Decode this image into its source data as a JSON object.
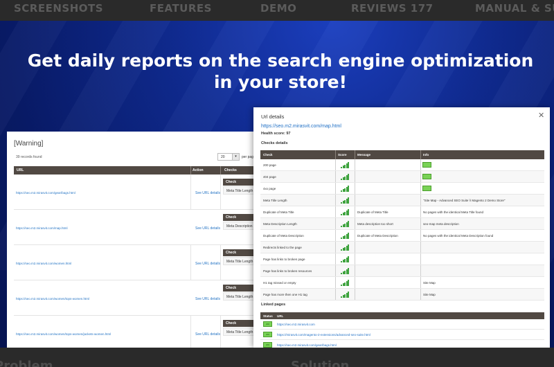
{
  "nav": {
    "items": [
      "SCREENSHOTS",
      "FEATURES",
      "DEMO",
      "REVIEWS 177",
      "MANUAL & SUP"
    ]
  },
  "hero": {
    "line1": "Get daily reports on the search engine optimization",
    "line2": "in your store!"
  },
  "bottom": {
    "left": "Problem",
    "right": "Solution"
  },
  "grid": {
    "title": "[Warning]",
    "records": "39 records found",
    "per_page_value": "20",
    "per_page_label": "per pag",
    "columns": [
      "URL",
      "Action",
      "Checks"
    ],
    "rows": [
      {
        "url": "https://seo.m2.mirasvit.com/gear/bags.html",
        "action": "See URL details",
        "check_head": "Check",
        "check_value": "Meta Title Length"
      },
      {
        "url": "https://seo.m2.mirasvit.com/map.html",
        "action": "See URL details",
        "check_head": "Check",
        "check_value": "Meta Description Le"
      },
      {
        "url": "https://seo.m2.mirasvit.com/women.html",
        "action": "See URL details",
        "check_head": "Check",
        "check_value": "Meta Title Length"
      },
      {
        "url": "https://seo.m2.mirasvit.com/women/tops-women.html",
        "action": "See URL details",
        "check_head": "Check",
        "check_value": "Meta Title Length"
      },
      {
        "url": "https://seo.m2.mirasvit.com/women/tops-women/jackets-women.html",
        "action": "See URL details",
        "check_head": "Check",
        "check_value": "Meta Title Length"
      }
    ]
  },
  "modal": {
    "title": "Url details",
    "url": "https://seo.m2.mirasvit.com/map.html",
    "health": "Health score: 97",
    "checks_title": "Checks details",
    "columns": [
      "Check",
      "Score",
      "Message",
      "Info"
    ],
    "rows": [
      {
        "check": "200 page",
        "message": "",
        "info": "",
        "badge": true,
        "score": 5
      },
      {
        "check": "404 page",
        "message": "",
        "info": "",
        "badge": true,
        "score": 5
      },
      {
        "check": "4xx page",
        "message": "",
        "info": "",
        "badge": true,
        "score": 5
      },
      {
        "check": "Meta Title Length",
        "message": "",
        "info": "\"Site Map - Advanced SEO Suite \\\\ Magento 2 Demo Store\"",
        "badge": false,
        "score": 5
      },
      {
        "check": "Duplicate of Meta Title",
        "message": "Duplicate of Meta Title",
        "info": "No pages with the identical Meta Title found",
        "badge": false,
        "score": 5
      },
      {
        "check": "Meta Description Length",
        "message": "Meta description too short",
        "info": "seo-map meta description",
        "badge": false,
        "score": 5
      },
      {
        "check": "Duplicate of Meta Description",
        "message": "Duplicate of Meta Description",
        "info": "No pages with the identical Meta Description found",
        "badge": false,
        "score": 5
      },
      {
        "check": "Redirects linked to the page",
        "message": "",
        "info": "",
        "badge": false,
        "score": 5
      },
      {
        "check": "Page has links to broken page",
        "message": "",
        "info": "",
        "badge": false,
        "score": 5
      },
      {
        "check": "Page has links to broken resources",
        "message": "",
        "info": "",
        "badge": false,
        "score": 5
      },
      {
        "check": "H1 tag missed or empty",
        "message": "",
        "info": "Site Map",
        "badge": false,
        "score": 5
      },
      {
        "check": "Page has more then one H1 tag",
        "message": "",
        "info": "Site Map",
        "badge": false,
        "score": 5
      }
    ],
    "linked_title": "Linked pages",
    "linked_columns": [
      "Status",
      "URL"
    ],
    "linked": [
      {
        "status": "200",
        "url": "https://seo.m2.mirasvit.com"
      },
      {
        "status": "200",
        "url": "https://mirasvit.com/magento-2-extensions/advanced-seo-suite.html"
      },
      {
        "status": "200",
        "url": "https://seo.m2.mirasvit.com/gear/bags.html"
      }
    ]
  },
  "colors": {
    "header": "#514943",
    "link": "#1f6fc5",
    "score_green": "#3ea33e",
    "badge_green": "#79d256"
  }
}
